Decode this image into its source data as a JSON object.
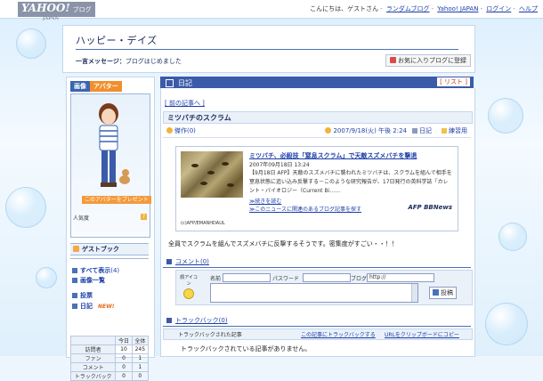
{
  "header": {
    "logo": "YAHOO!",
    "logo_sub": "ブログ",
    "logo_country": "JAPAN",
    "greeting": "こんにちは、ゲストさん",
    "links": [
      "ランダムブログ",
      "Yahoo! JAPAN",
      "ログイン",
      "ヘルプ"
    ]
  },
  "blog": {
    "title": "ハッピー・デイズ",
    "message_label": "一言メッセージ：",
    "message": "ブログはじめました",
    "favorite_button": "お気に入りブログに登録"
  },
  "sidebar": {
    "tabs": [
      "画像",
      "アバター"
    ],
    "active_tab": "アバター",
    "present_label": "このアバターをプレゼント",
    "popularity_label": "人気度",
    "help_label": "?",
    "guestbook_label": "ゲストブック",
    "links": [
      {
        "label": "すべて表示",
        "count": "(4)"
      },
      {
        "label": "画像一覧",
        "count": ""
      },
      {
        "label": "投票",
        "count": ""
      },
      {
        "label": "日記",
        "count": "",
        "badge": "NEW!"
      }
    ],
    "stats": {
      "headers": [
        "",
        "今日",
        "全体"
      ],
      "rows": [
        {
          "label": "訪問者",
          "today": "10",
          "total": "245"
        },
        {
          "label": "ファン",
          "today": "0",
          "total": "1"
        },
        {
          "label": "コメント",
          "today": "0",
          "total": "1"
        },
        {
          "label": "トラックバック",
          "today": "0",
          "total": "0"
        }
      ]
    }
  },
  "main": {
    "section_title": "日記",
    "list_button": "[ リスト ]",
    "prev_link": "[ 前の記事へ ]",
    "entry": {
      "title": "ミツバチのスクラム",
      "rating": "傑作(0)",
      "date": "2007/9/18(火) 午後 2:24",
      "category": "日記",
      "folder": "練習用"
    },
    "news": {
      "title": "ミツバチ、必殺技「窒息スクラム」で天敵スズメバチを撃退",
      "date": "2007年09月18日 13:24",
      "body": "【9月18日 AFP】天敵のスズメバチに襲われたミツバチは、スクラムを組んで相手を窒息状態に追い込み反撃する－このような研究報告が、17日発行の英科学誌「カレント・バイオロジー（Current Bi……",
      "more": "≫続きを読む",
      "related": "≫このニュースに関連のあるブログ記事を探す",
      "credit": "(c)AFP/EMANHDAUL",
      "provider": "AFP BBNews"
    },
    "body_text": "全員でスクラムを組んでスズメバチに反撃するそうです。密集度がすごい・・！！",
    "comments": {
      "header": "コメント(0)",
      "face_label": "顔アイコン",
      "name_label": "名前",
      "password_label": "パスワード",
      "blog_label": "ブログ",
      "blog_value": "http://",
      "post_button": "投稿"
    },
    "trackback": {
      "header": "トラックバック(0)",
      "col_label": "トラックバックされた記事",
      "action1": "この記事にトラックバックする",
      "action2": "URLをクリップボードにコピー",
      "none": "トラックバックされている記事がありません。"
    }
  }
}
